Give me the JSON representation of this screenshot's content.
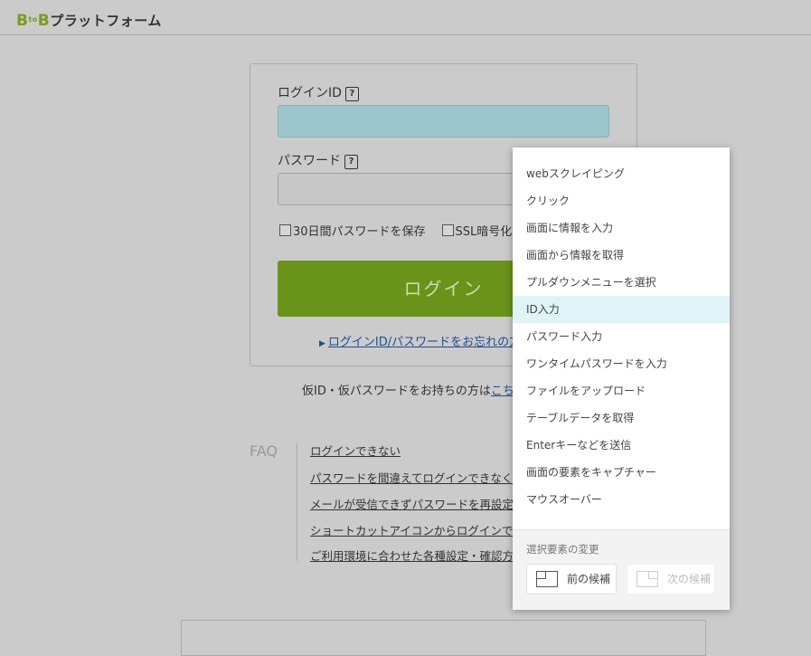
{
  "header": {
    "logo_b1": "B",
    "logo_to": "to",
    "logo_b2": "B",
    "logo_text": "プラットフォーム"
  },
  "login": {
    "id_label": "ログインID",
    "help_glyph": "?",
    "id_value": "",
    "password_label": "パスワード",
    "password_value": "",
    "remember_label": "30日間パスワードを保存",
    "ssl_label": "SSL暗号化",
    "login_button": "ログイン",
    "forgot_link": "ログインID/パスワードをお忘れの方",
    "temp_text": "仮ID・仮パスワードをお持ちの方は",
    "temp_link": "こち"
  },
  "faq": {
    "title": "FAQ",
    "links": [
      "ログインできない",
      "パスワードを間違えてログインできなくな",
      "メールが受信できずパスワードを再設定で",
      "ショートカットアイコンからログインでき",
      "ご利用環境に合わせた各種設定・確認方法"
    ]
  },
  "context_menu": {
    "items": [
      "webスクレイピング",
      "クリック",
      "画面に情報を入力",
      "画面から情報を取得",
      "プルダウンメニューを選択",
      "ID入力",
      "パスワード入力",
      "ワンタイムパスワードを入力",
      "ファイルをアップロード",
      "テーブルデータを取得",
      "Enterキーなどを送信",
      "画面の要素をキャプチャー",
      "マウスオーバー"
    ],
    "active_index": 5,
    "footer_label": "選択要素の変更",
    "prev_button": "前の候補",
    "next_button": "次の候補"
  },
  "colors": {
    "accent_green": "#6a931a",
    "menu_highlight": "#e0f4f8",
    "focused_input": "#9dc6cc"
  }
}
